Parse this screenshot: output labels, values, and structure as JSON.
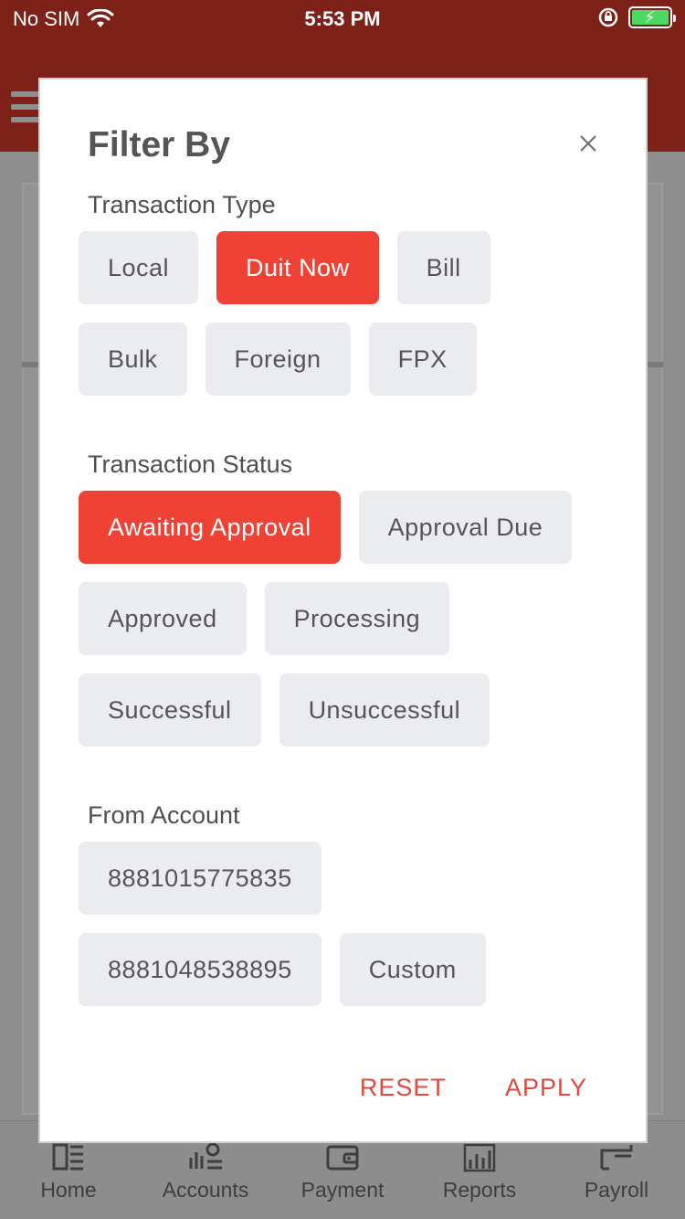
{
  "status_bar": {
    "carrier": "No SIM",
    "time": "5:53 PM"
  },
  "modal": {
    "title": "Filter By",
    "transaction_type": {
      "label": "Transaction Type",
      "rows": [
        [
          {
            "label": "Local",
            "selected": false
          },
          {
            "label": "Duit Now",
            "selected": true
          },
          {
            "label": "Bill",
            "selected": false
          }
        ],
        [
          {
            "label": "Bulk",
            "selected": false
          },
          {
            "label": "Foreign",
            "selected": false
          },
          {
            "label": "FPX",
            "selected": false
          }
        ]
      ]
    },
    "transaction_status": {
      "label": "Transaction Status",
      "rows": [
        [
          {
            "label": "Awaiting Approval",
            "selected": true
          },
          {
            "label": "Approval Due",
            "selected": false
          }
        ],
        [
          {
            "label": "Approved",
            "selected": false
          },
          {
            "label": "Processing",
            "selected": false
          }
        ],
        [
          {
            "label": "Successful",
            "selected": false
          },
          {
            "label": "Unsuccessful",
            "selected": false
          }
        ]
      ]
    },
    "from_account": {
      "label": "From Account",
      "rows": [
        [
          {
            "label": "8881015775835",
            "selected": false
          }
        ],
        [
          {
            "label": "8881048538895",
            "selected": false
          },
          {
            "label": "Custom",
            "selected": false
          }
        ]
      ]
    },
    "reset_label": "RESET",
    "apply_label": "APPLY"
  },
  "tabbar": {
    "items": [
      {
        "label": "Home",
        "icon": "home-icon"
      },
      {
        "label": "Accounts",
        "icon": "accounts-icon"
      },
      {
        "label": "Payment",
        "icon": "wallet-icon"
      },
      {
        "label": "Reports",
        "icon": "reports-icon"
      },
      {
        "label": "Payroll",
        "icon": "payroll-icon"
      }
    ]
  },
  "colors": {
    "header": "#7d2119",
    "accent": "#ef4134",
    "chip_bg": "#ebecef",
    "action_text": "#e0493c"
  }
}
